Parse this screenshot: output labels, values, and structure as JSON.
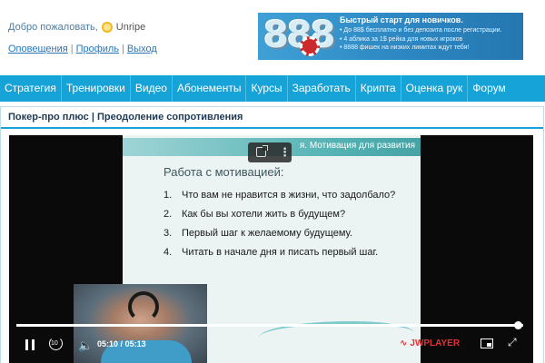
{
  "header": {
    "welcome_text": "Добро пожаловать,",
    "user_icon": "sun-icon",
    "username": "Unripe",
    "links": [
      {
        "label": "Оповещения"
      },
      {
        "label": "Профиль"
      },
      {
        "label": "Выход"
      }
    ],
    "link_separator": "|"
  },
  "banner": {
    "big_text": "888",
    "title": "Быстрый старт для новичков.",
    "bullets": [
      "До 88$ бесплатно и без депозита после регистрации.",
      "4 аблика за 1$ рейка для новых игроков",
      "8888 фишек на низких лимитах ждут тебя!"
    ]
  },
  "nav": {
    "items": [
      {
        "label": "Стратегия"
      },
      {
        "label": "Тренировки"
      },
      {
        "label": "Видео"
      },
      {
        "label": "Абонементы"
      },
      {
        "label": "Курсы"
      },
      {
        "label": "Заработать"
      },
      {
        "label": "Крипта"
      },
      {
        "label": "Оценка рук"
      },
      {
        "label": "Форум"
      }
    ]
  },
  "breadcrumb": "Покер-про плюс | Преодоление сопротивления",
  "player": {
    "slide": {
      "header": "я. Мотивация для развития",
      "title": "Работа с мотивацией:",
      "items": [
        {
          "num": "1.",
          "text": "Что вам не нравится в жизни, что задолбало?"
        },
        {
          "num": "2.",
          "text": "Как бы вы хотели жить в будущем?"
        },
        {
          "num": "3.",
          "text": "Первый шаг к желаемому будущему."
        },
        {
          "num": "4.",
          "text": "Читать в начале дня и писать первый шаг."
        }
      ]
    },
    "current_time": "05:10",
    "duration": "05:13",
    "time_separator": "/",
    "progress_fraction": 0.99,
    "rewind_seconds": "10",
    "brand": "JWPLAYER",
    "colors": {
      "nav_bg": "#16a3d8",
      "brand_red": "#e13434",
      "slide_teal": "#55b3b4"
    }
  }
}
